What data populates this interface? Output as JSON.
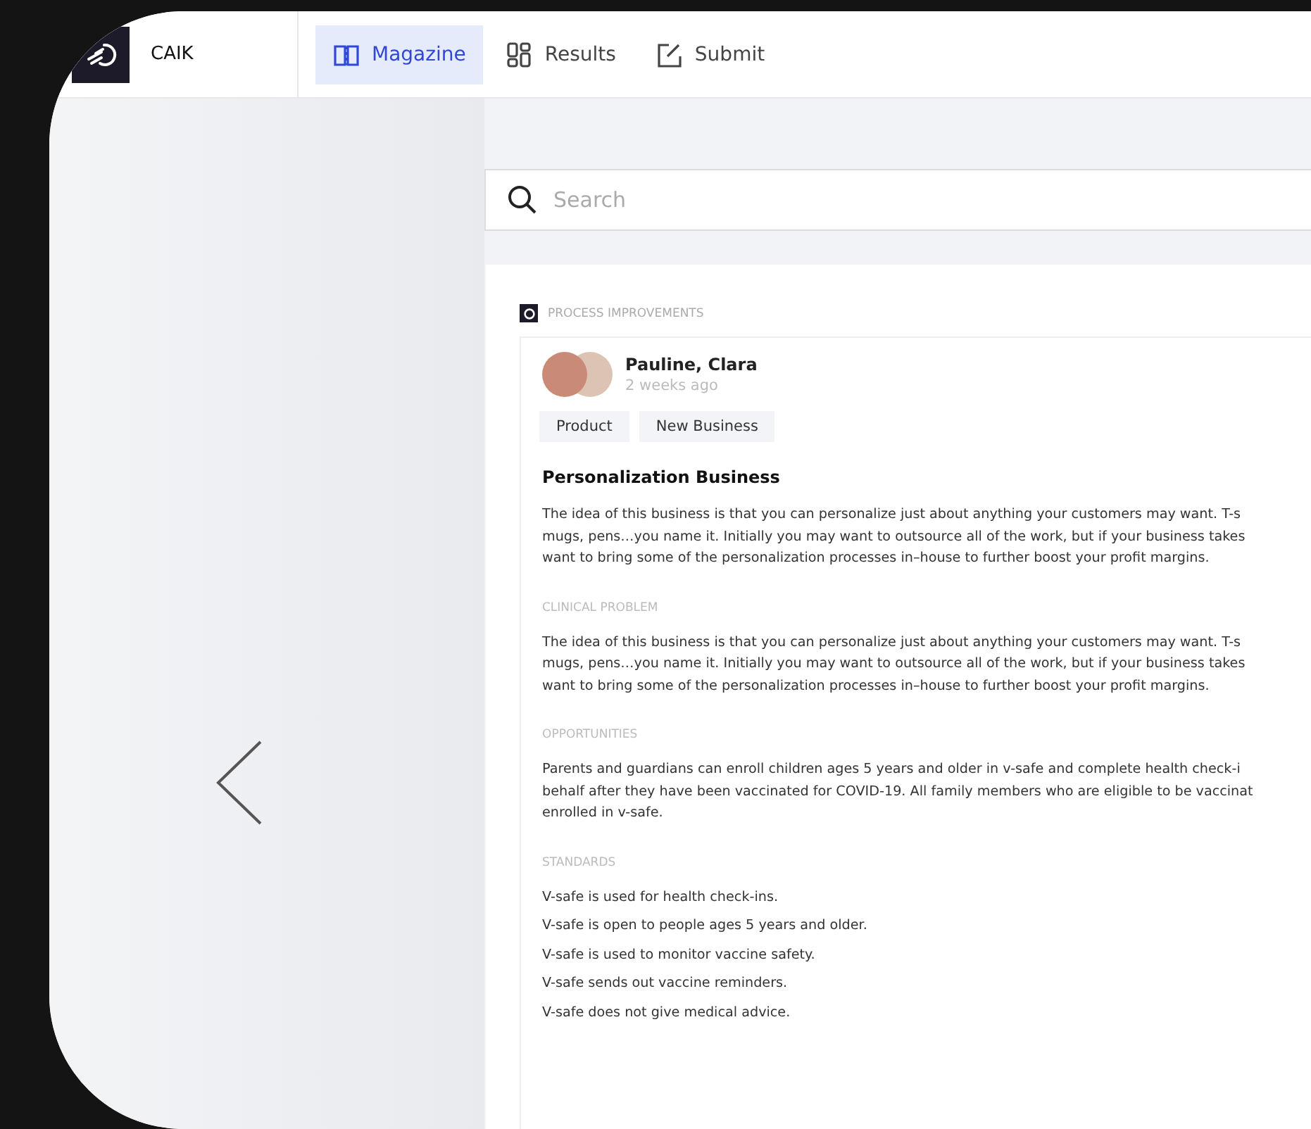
{
  "header": {
    "brand": "CAIK",
    "nav": [
      {
        "label": "Magazine",
        "selected": true
      },
      {
        "label": "Results",
        "selected": false
      },
      {
        "label": "Submit",
        "selected": false
      }
    ]
  },
  "search": {
    "placeholder": "Search"
  },
  "article": {
    "category": "PROCESS IMPROVEMENTS",
    "authors": "Pauline, Clara",
    "time": "2 weeks ago",
    "tags": [
      "Product",
      "New Business"
    ],
    "title": "Personalization Business",
    "intro": [
      "The idea of this business is that you can personalize just about anything your customers may want. T-s",
      "mugs, pens…you name it. Initially you may want to outsource all of the work, but if your business takes",
      "want to bring some of the personalization processes in–house to further boost your profit margins."
    ],
    "sections": [
      {
        "heading": "CLINICAL PROBLEM",
        "kind": "paragraph",
        "lines": [
          "The idea of this business is that you can personalize just about anything your customers may want. T-s",
          "mugs, pens…you name it. Initially you may want to outsource all of the work, but if your business takes",
          "want to bring some of the personalization processes in–house to further boost your profit margins."
        ]
      },
      {
        "heading": "OPPORTUNITIES",
        "kind": "paragraph",
        "lines": [
          "Parents and guardians can enroll children ages 5 years and older in v-safe and complete health check-i",
          "behalf after they have been vaccinated for COVID-19. All family members who are eligible to be vaccinat",
          "enrolled in v-safe."
        ]
      },
      {
        "heading": "STANDARDS",
        "kind": "list",
        "lines": [
          "V-safe is used for health check-ins.",
          "V-safe is open to people ages 5 years and older.",
          "V-safe is used to monitor vaccine safety.",
          "V-safe sends out vaccine reminders.",
          "V-safe does not give medical advice."
        ]
      }
    ]
  }
}
